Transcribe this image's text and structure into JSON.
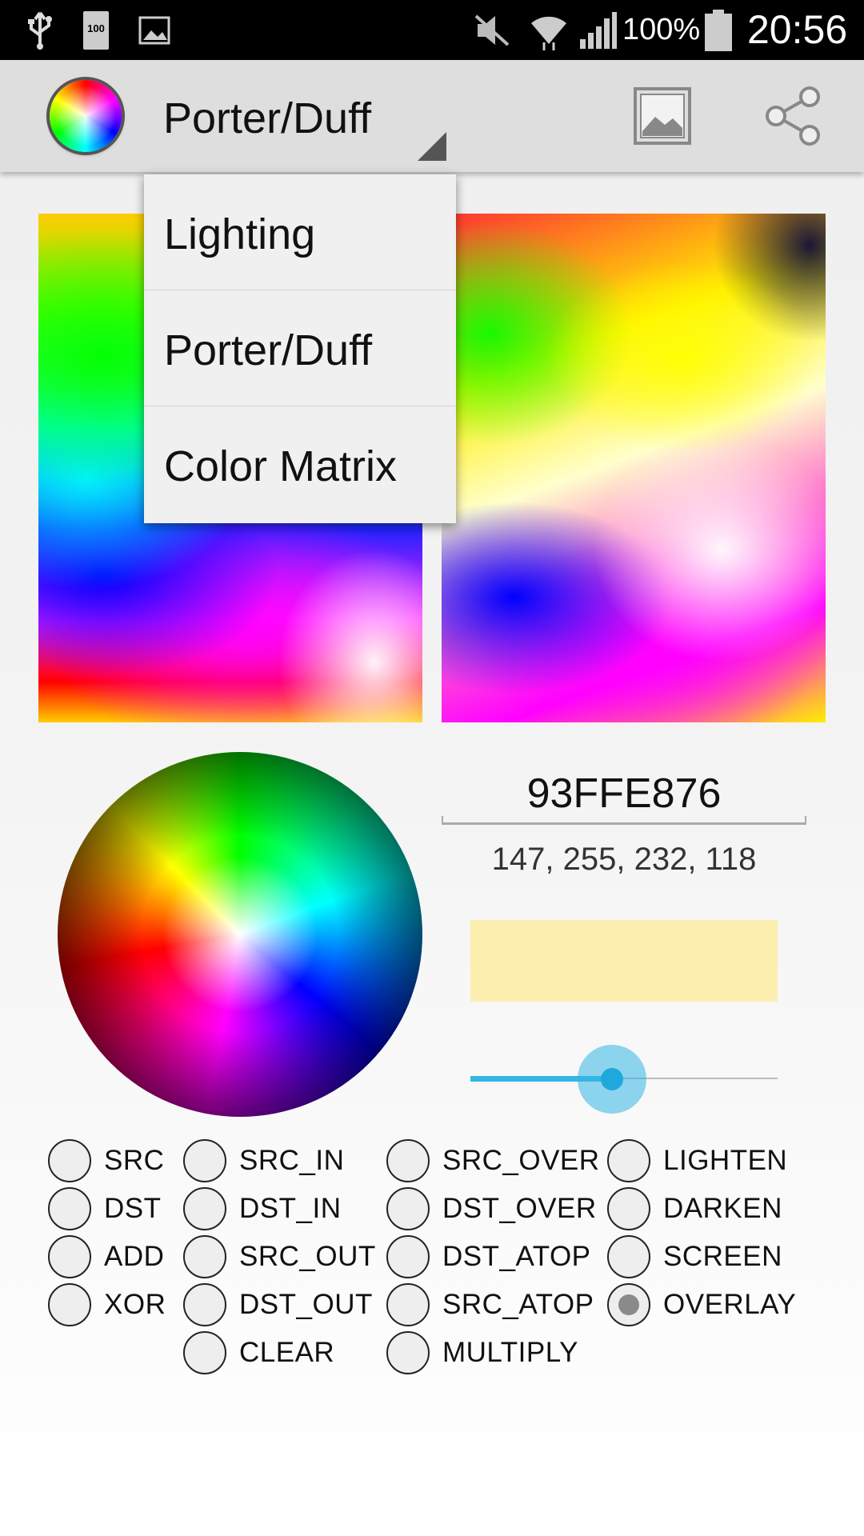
{
  "status_bar": {
    "battery_small_label": "100",
    "battery_percent": "100%",
    "time": "20:56"
  },
  "action_bar": {
    "spinner_selected": "Porter/Duff",
    "icons": [
      "color-wheel-logo-icon",
      "image-icon",
      "share-icon"
    ]
  },
  "dropdown": {
    "items": [
      "Lighting",
      "Porter/Duff",
      "Color Matrix"
    ]
  },
  "color": {
    "hex": "93FFE876",
    "rgba": "147, 255, 232, 118",
    "swatch_color": "#FCEEAF"
  },
  "alpha_slider": {
    "value": 0.46,
    "accent_color": "#33B5E5"
  },
  "modes": {
    "col1": [
      "SRC",
      "DST",
      "ADD",
      "XOR"
    ],
    "col2": [
      "SRC_IN",
      "DST_IN",
      "SRC_OUT",
      "DST_OUT",
      "CLEAR"
    ],
    "col3": [
      "SRC_OVER",
      "DST_OVER",
      "DST_ATOP",
      "SRC_ATOP",
      "MULTIPLY"
    ],
    "col4": [
      "LIGHTEN",
      "DARKEN",
      "SCREEN",
      "OVERLAY"
    ],
    "selected": "OVERLAY"
  }
}
